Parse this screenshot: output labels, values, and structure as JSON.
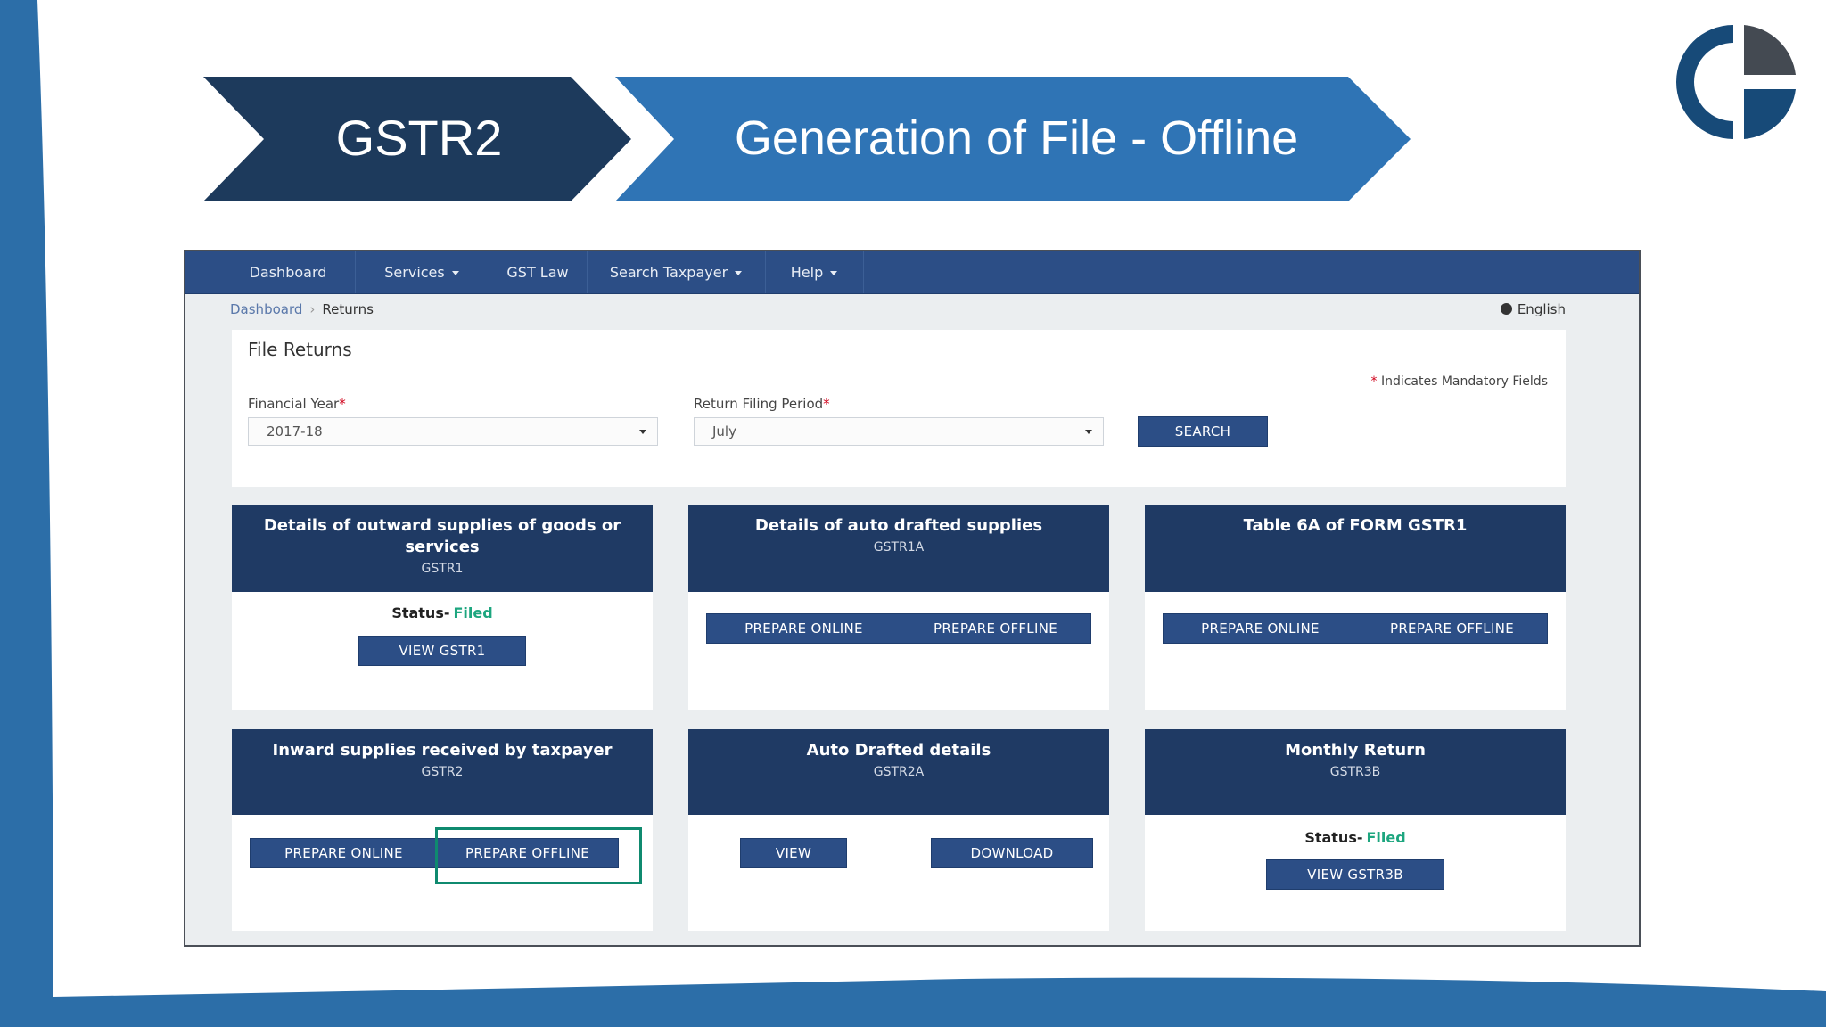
{
  "slide": {
    "title_left": "GSTR2",
    "title_right": "Generation of File - Offline",
    "logo_icon": "company-logo-icon",
    "colors": {
      "dark_navy": "#1d3a5c",
      "blue_arrow": "#2f74b5",
      "frame_blue": "#2c6ea8"
    }
  },
  "portal": {
    "nav": [
      {
        "label": "Dashboard",
        "dropdown": false
      },
      {
        "label": "Services",
        "dropdown": true
      },
      {
        "label": "GST Law",
        "dropdown": false
      },
      {
        "label": "Search Taxpayer",
        "dropdown": true
      },
      {
        "label": "Help",
        "dropdown": true
      }
    ],
    "breadcrumb": {
      "link": "Dashboard",
      "current": "Returns"
    },
    "language": "English",
    "file_returns": {
      "title": "File Returns",
      "mandatory_note": "Indicates Mandatory Fields",
      "financial_year_label": "Financial Year",
      "financial_year_value": "2017-18",
      "period_label": "Return Filing Period",
      "period_value": "July",
      "search_label": "SEARCH"
    },
    "cards": {
      "c1": {
        "title": "Details of outward supplies of goods or services",
        "sub": "GSTR1",
        "status_label": "Status-",
        "status_value": "Filed",
        "btn": "VIEW GSTR1"
      },
      "c2": {
        "title": "Details of auto drafted supplies",
        "sub": "GSTR1A",
        "btn1": "PREPARE ONLINE",
        "btn2": "PREPARE OFFLINE"
      },
      "c3": {
        "title": "Table 6A of FORM GSTR1",
        "btn1": "PREPARE ONLINE",
        "btn2": "PREPARE OFFLINE"
      },
      "c4": {
        "title": "Inward supplies received by taxpayer",
        "sub": "GSTR2",
        "btn1": "PREPARE ONLINE",
        "btn2": "PREPARE OFFLINE"
      },
      "c5": {
        "title": "Auto Drafted details",
        "sub": "GSTR2A",
        "btn1": "VIEW",
        "btn2": "DOWNLOAD"
      },
      "c6": {
        "title": "Monthly Return",
        "sub": "GSTR3B",
        "status_label": "Status-",
        "status_value": "Filed",
        "btn": "VIEW GSTR3B"
      }
    }
  }
}
